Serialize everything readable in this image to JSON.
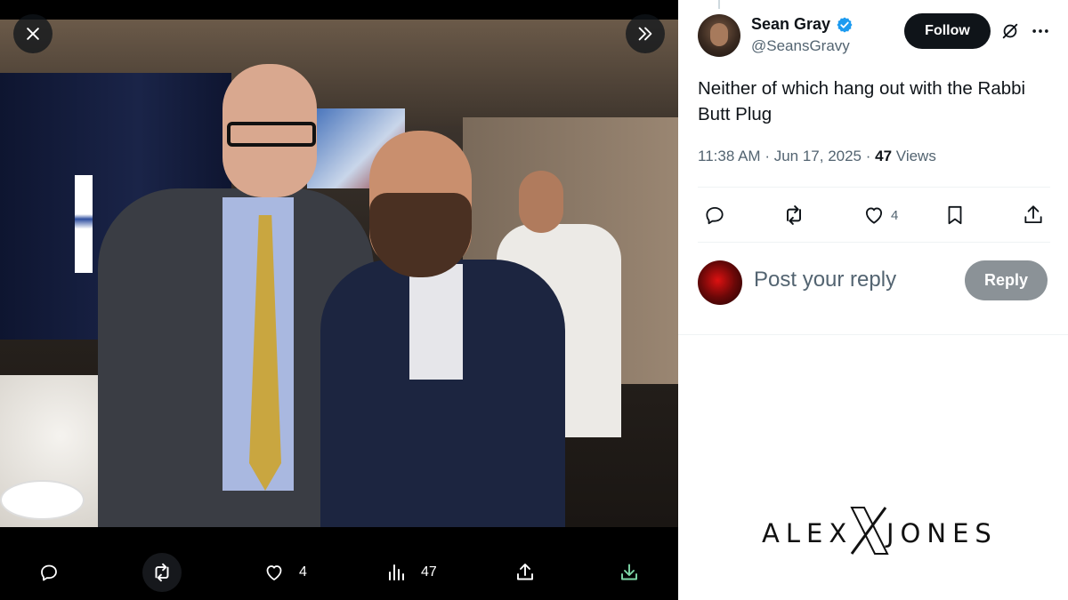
{
  "viewer": {
    "actions": {
      "reply_count": "",
      "retweet_count": "",
      "like_count": "4",
      "views_count": "47"
    }
  },
  "tweet": {
    "author_name": "Sean Gray",
    "author_handle": "@SeansGravy",
    "follow_label": "Follow",
    "text": "Neither of which hang out with the Rabbi Butt Plug",
    "time": "11:38 AM",
    "date": "Jun 17, 2025",
    "views_count": "47",
    "views_label": "Views",
    "like_count": "4"
  },
  "reply": {
    "placeholder": "Post your reply",
    "button_label": "Reply"
  },
  "watermark": {
    "left": "ALEX",
    "right": "JONES"
  },
  "colors": {
    "accent_blue": "#1d9bf0",
    "text_primary": "#0f1419",
    "text_secondary": "#536471",
    "reply_button_disabled": "#8b9297"
  },
  "icons": {
    "close": "close-icon",
    "expand": "double-chevron-right-icon",
    "reply": "speech-bubble-icon",
    "retweet": "retweet-icon",
    "like": "heart-icon",
    "views": "bar-chart-icon",
    "share": "share-icon",
    "download": "download-icon",
    "bookmark": "bookmark-icon",
    "grok": "grok-icon",
    "more": "more-dots-icon",
    "verified": "verified-badge-icon"
  }
}
